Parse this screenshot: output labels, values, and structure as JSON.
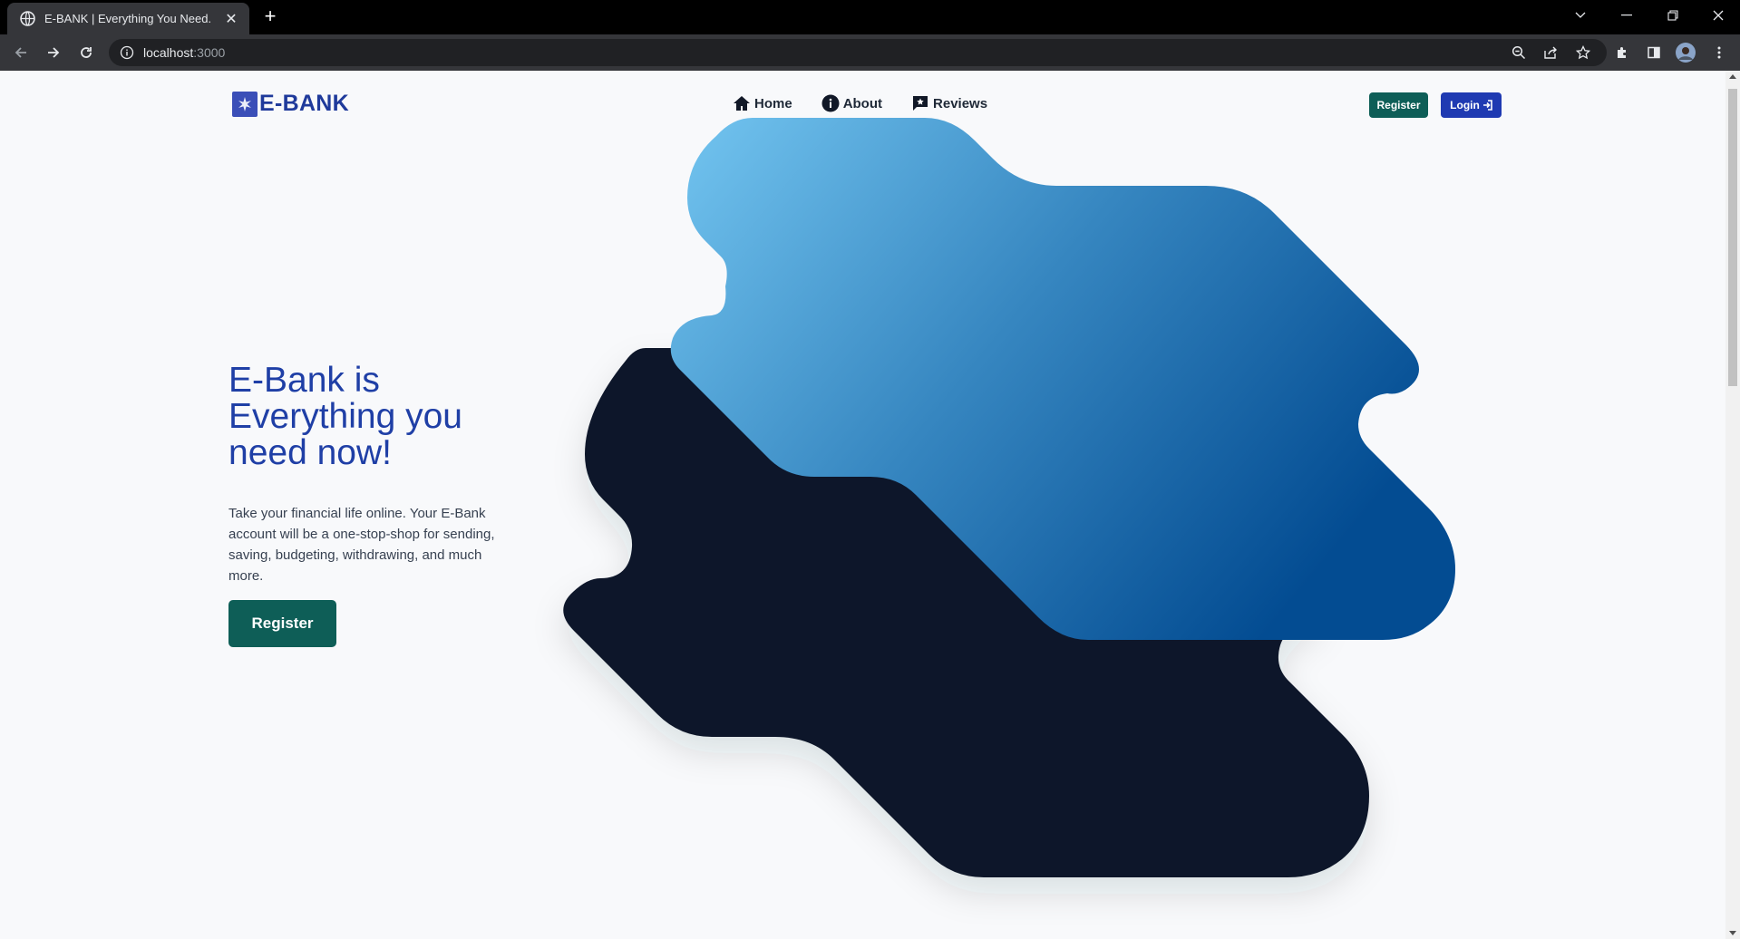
{
  "browser": {
    "tab_title": "E-BANK | Everything You Need.",
    "url_host": "localhost",
    "url_port": ":3000"
  },
  "header": {
    "brand": "E-BANK",
    "nav": [
      {
        "label": "Home",
        "icon": "home-icon"
      },
      {
        "label": "About",
        "icon": "info-icon"
      },
      {
        "label": "Reviews",
        "icon": "reviews-icon"
      }
    ],
    "register_label": "Register",
    "login_label": "Login"
  },
  "hero": {
    "title": "E-Bank is Everything you need now!",
    "description": "Take your financial life online. Your E-Bank account will be a one-stop-shop for sending, saving, budgeting, withdrawing, and much more.",
    "cta_label": "Register"
  },
  "colors": {
    "brand_blue": "#1f3fa6",
    "register_green": "#0e5e57",
    "login_blue": "#1f3ab2",
    "blob_dark": "#111729",
    "blob_light": "#72c3ef",
    "blob_deep": "#044d93"
  }
}
